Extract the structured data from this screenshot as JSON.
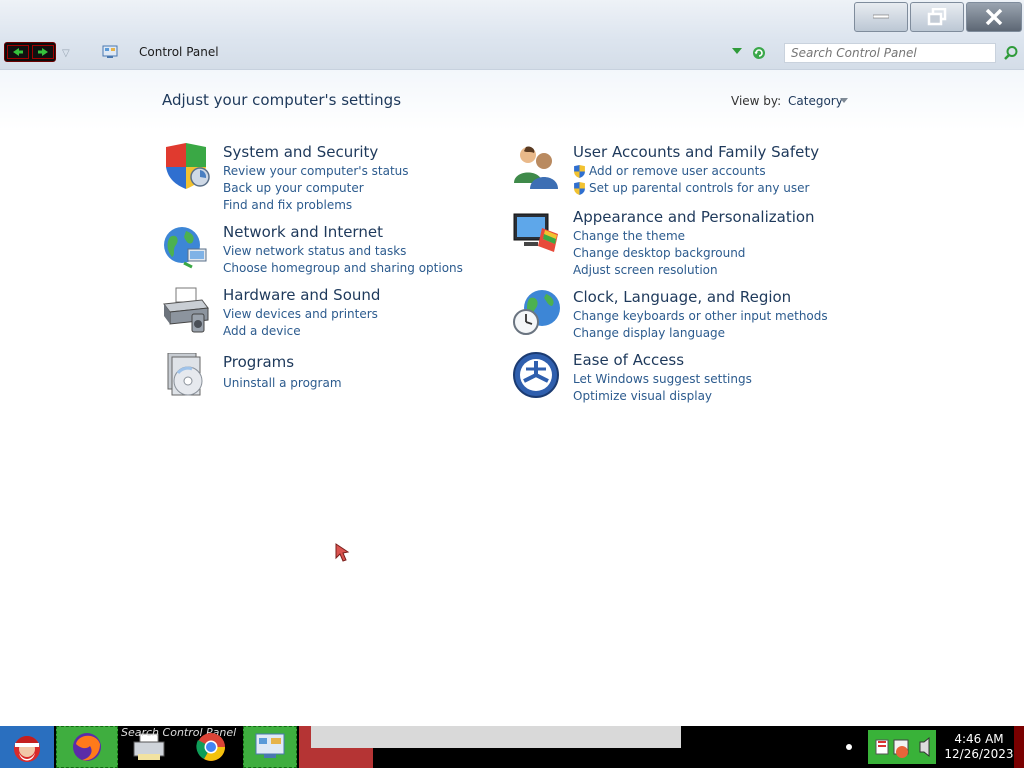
{
  "window": {
    "breadcrumb": "Control Panel",
    "search_placeholder": "Search Control Panel"
  },
  "main": {
    "heading": "Adjust your computer's settings",
    "view_by_label": "View by:",
    "view_by_value": "Category"
  },
  "categories": [
    {
      "title": "System and Security",
      "icon": "shield-icon",
      "links": [
        "Review your computer's status",
        "Back up your computer",
        "Find and fix problems"
      ]
    },
    {
      "title": "Network and Internet",
      "icon": "globe-network-icon",
      "links": [
        "View network status and tasks",
        "Choose homegroup and sharing options"
      ]
    },
    {
      "title": "Hardware and Sound",
      "icon": "printer-icon",
      "links": [
        "View devices and printers",
        "Add a device"
      ]
    },
    {
      "title": "Programs",
      "icon": "programs-icon",
      "links": [
        "Uninstall a program"
      ]
    },
    {
      "title": "User Accounts and Family Safety",
      "icon": "users-icon",
      "links": [
        "Add or remove user accounts",
        "Set up parental controls for any user"
      ]
    },
    {
      "title": "Appearance and Personalization",
      "icon": "monitor-paint-icon",
      "links": [
        "Change the theme",
        "Change desktop background",
        "Adjust screen resolution"
      ]
    },
    {
      "title": "Clock, Language, and Region",
      "icon": "clock-globe-icon",
      "links": [
        "Change keyboards or other input methods",
        "Change display language"
      ]
    },
    {
      "title": "Ease of Access",
      "icon": "ease-of-access-icon",
      "links": [
        "Let Windows suggest settings",
        "Optimize visual display"
      ]
    }
  ],
  "taskbar": {
    "search_overlay": "Search Control Panel",
    "time": "4:46 AM",
    "date": "12/26/2023"
  },
  "colors": {
    "heading": "#1e395b",
    "link": "#2c5b8e",
    "taskbar": "#000000"
  }
}
